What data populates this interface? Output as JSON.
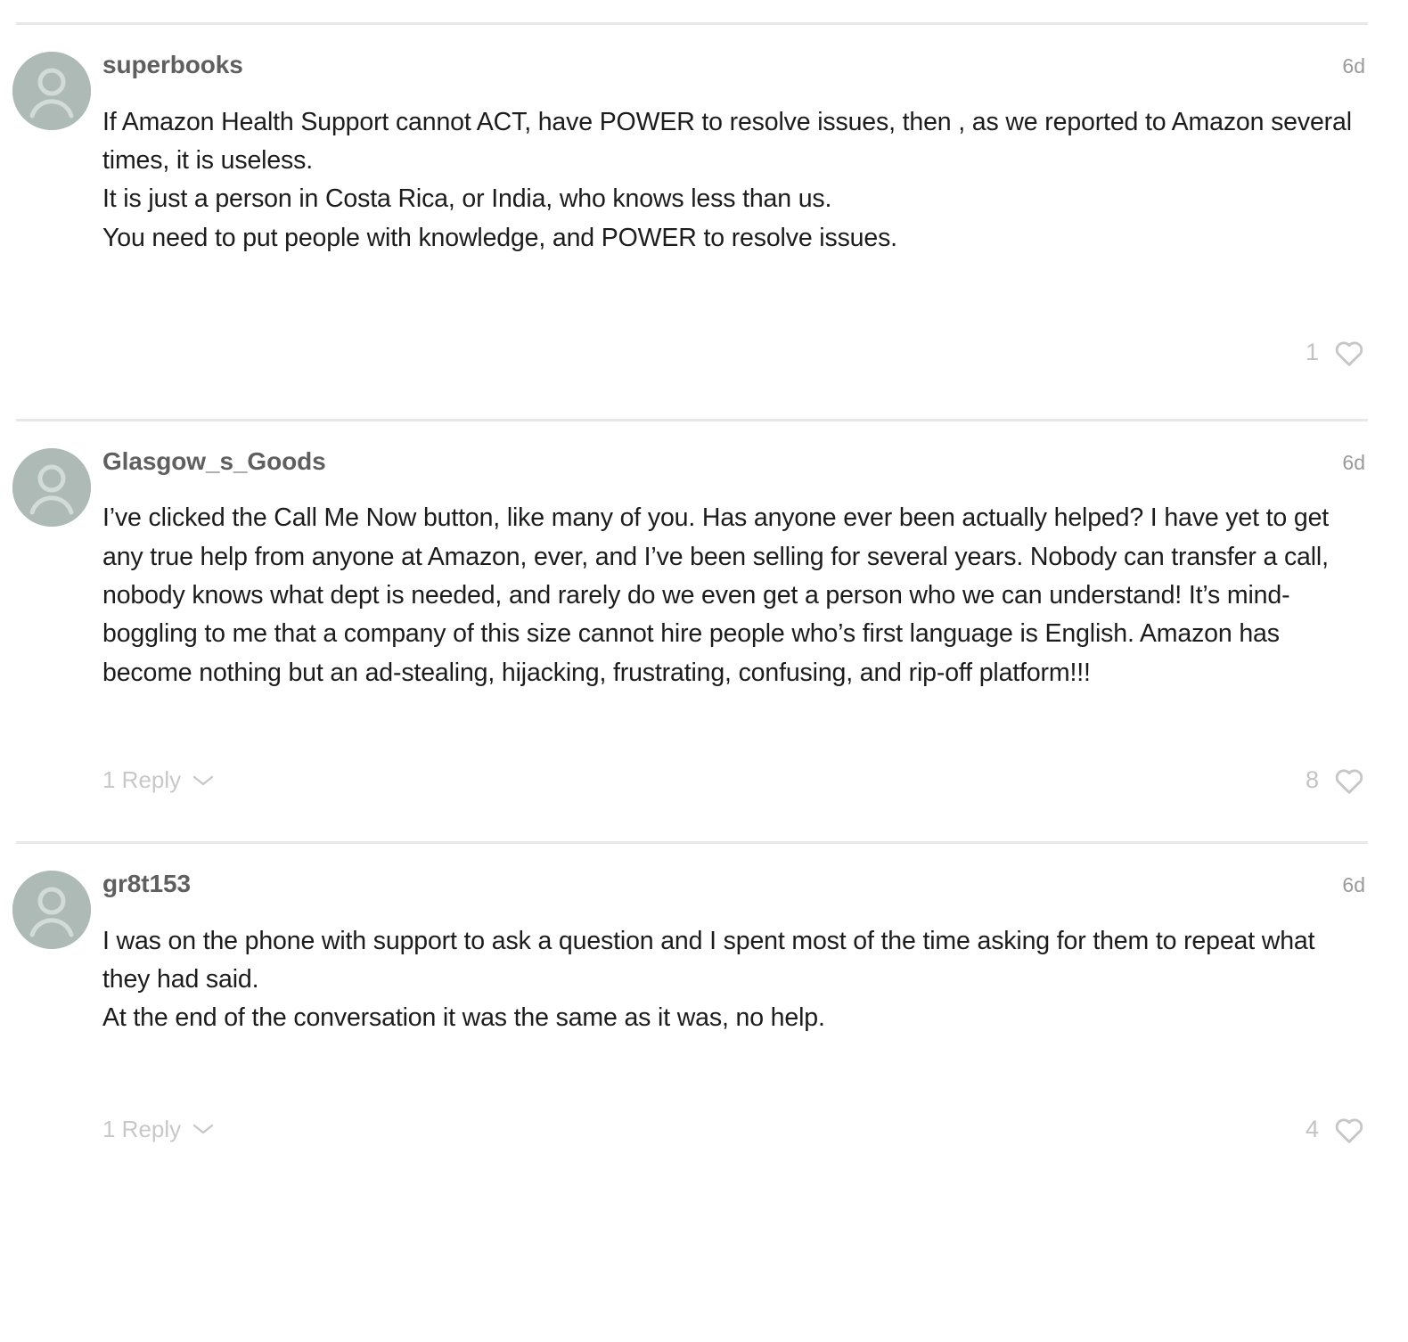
{
  "thread": {
    "comments": [
      {
        "username": "superbooks",
        "timestamp": "6d",
        "lines": [
          "If Amazon Health Support cannot ACT, have POWER to resolve issues, then , as we reported to Amazon several times, it is useless.",
          "It is just a person in Costa Rica, or India, who knows less than us.",
          "You need to put people with knowledge, and POWER to resolve issues."
        ],
        "replies_label": "",
        "like_count": "1",
        "avatar_icon": "person-avatar-icon",
        "heart_icon": "heart-outline-icon"
      },
      {
        "username": "Glasgow_s_Goods",
        "timestamp": "6d",
        "lines": [
          "I’ve clicked the Call Me Now button, like many of you. Has anyone ever been actually helped? I have yet to get any true help from anyone at Amazon, ever, and I’ve been selling for several years. Nobody can transfer a call, nobody knows what dept is needed, and rarely do we even get a person who we can understand! It’s mind-boggling to me that a company of this size cannot hire people who’s first language is English. Amazon has become nothing but an ad-stealing, hijacking, frustrating, confusing, and rip-off platform!!!"
        ],
        "replies_label": "1 Reply",
        "like_count": "8",
        "avatar_icon": "person-avatar-icon",
        "heart_icon": "heart-outline-icon"
      },
      {
        "username": "gr8t153",
        "timestamp": "6d",
        "lines": [
          "I was on the phone with support to ask a question and I spent most of the time asking for them to repeat what they had said.",
          "At the end of the conversation it was the same as it was, no help."
        ],
        "replies_label": "1 Reply",
        "like_count": "4",
        "avatar_icon": "person-avatar-icon",
        "heart_icon": "heart-outline-icon"
      }
    ],
    "colors": {
      "divider": "#e8e8e8",
      "avatar_bg": "#aebab6",
      "username": "#5f5f5f",
      "muted": "#c3c3c3",
      "body_text": "#1c1c1c"
    }
  }
}
